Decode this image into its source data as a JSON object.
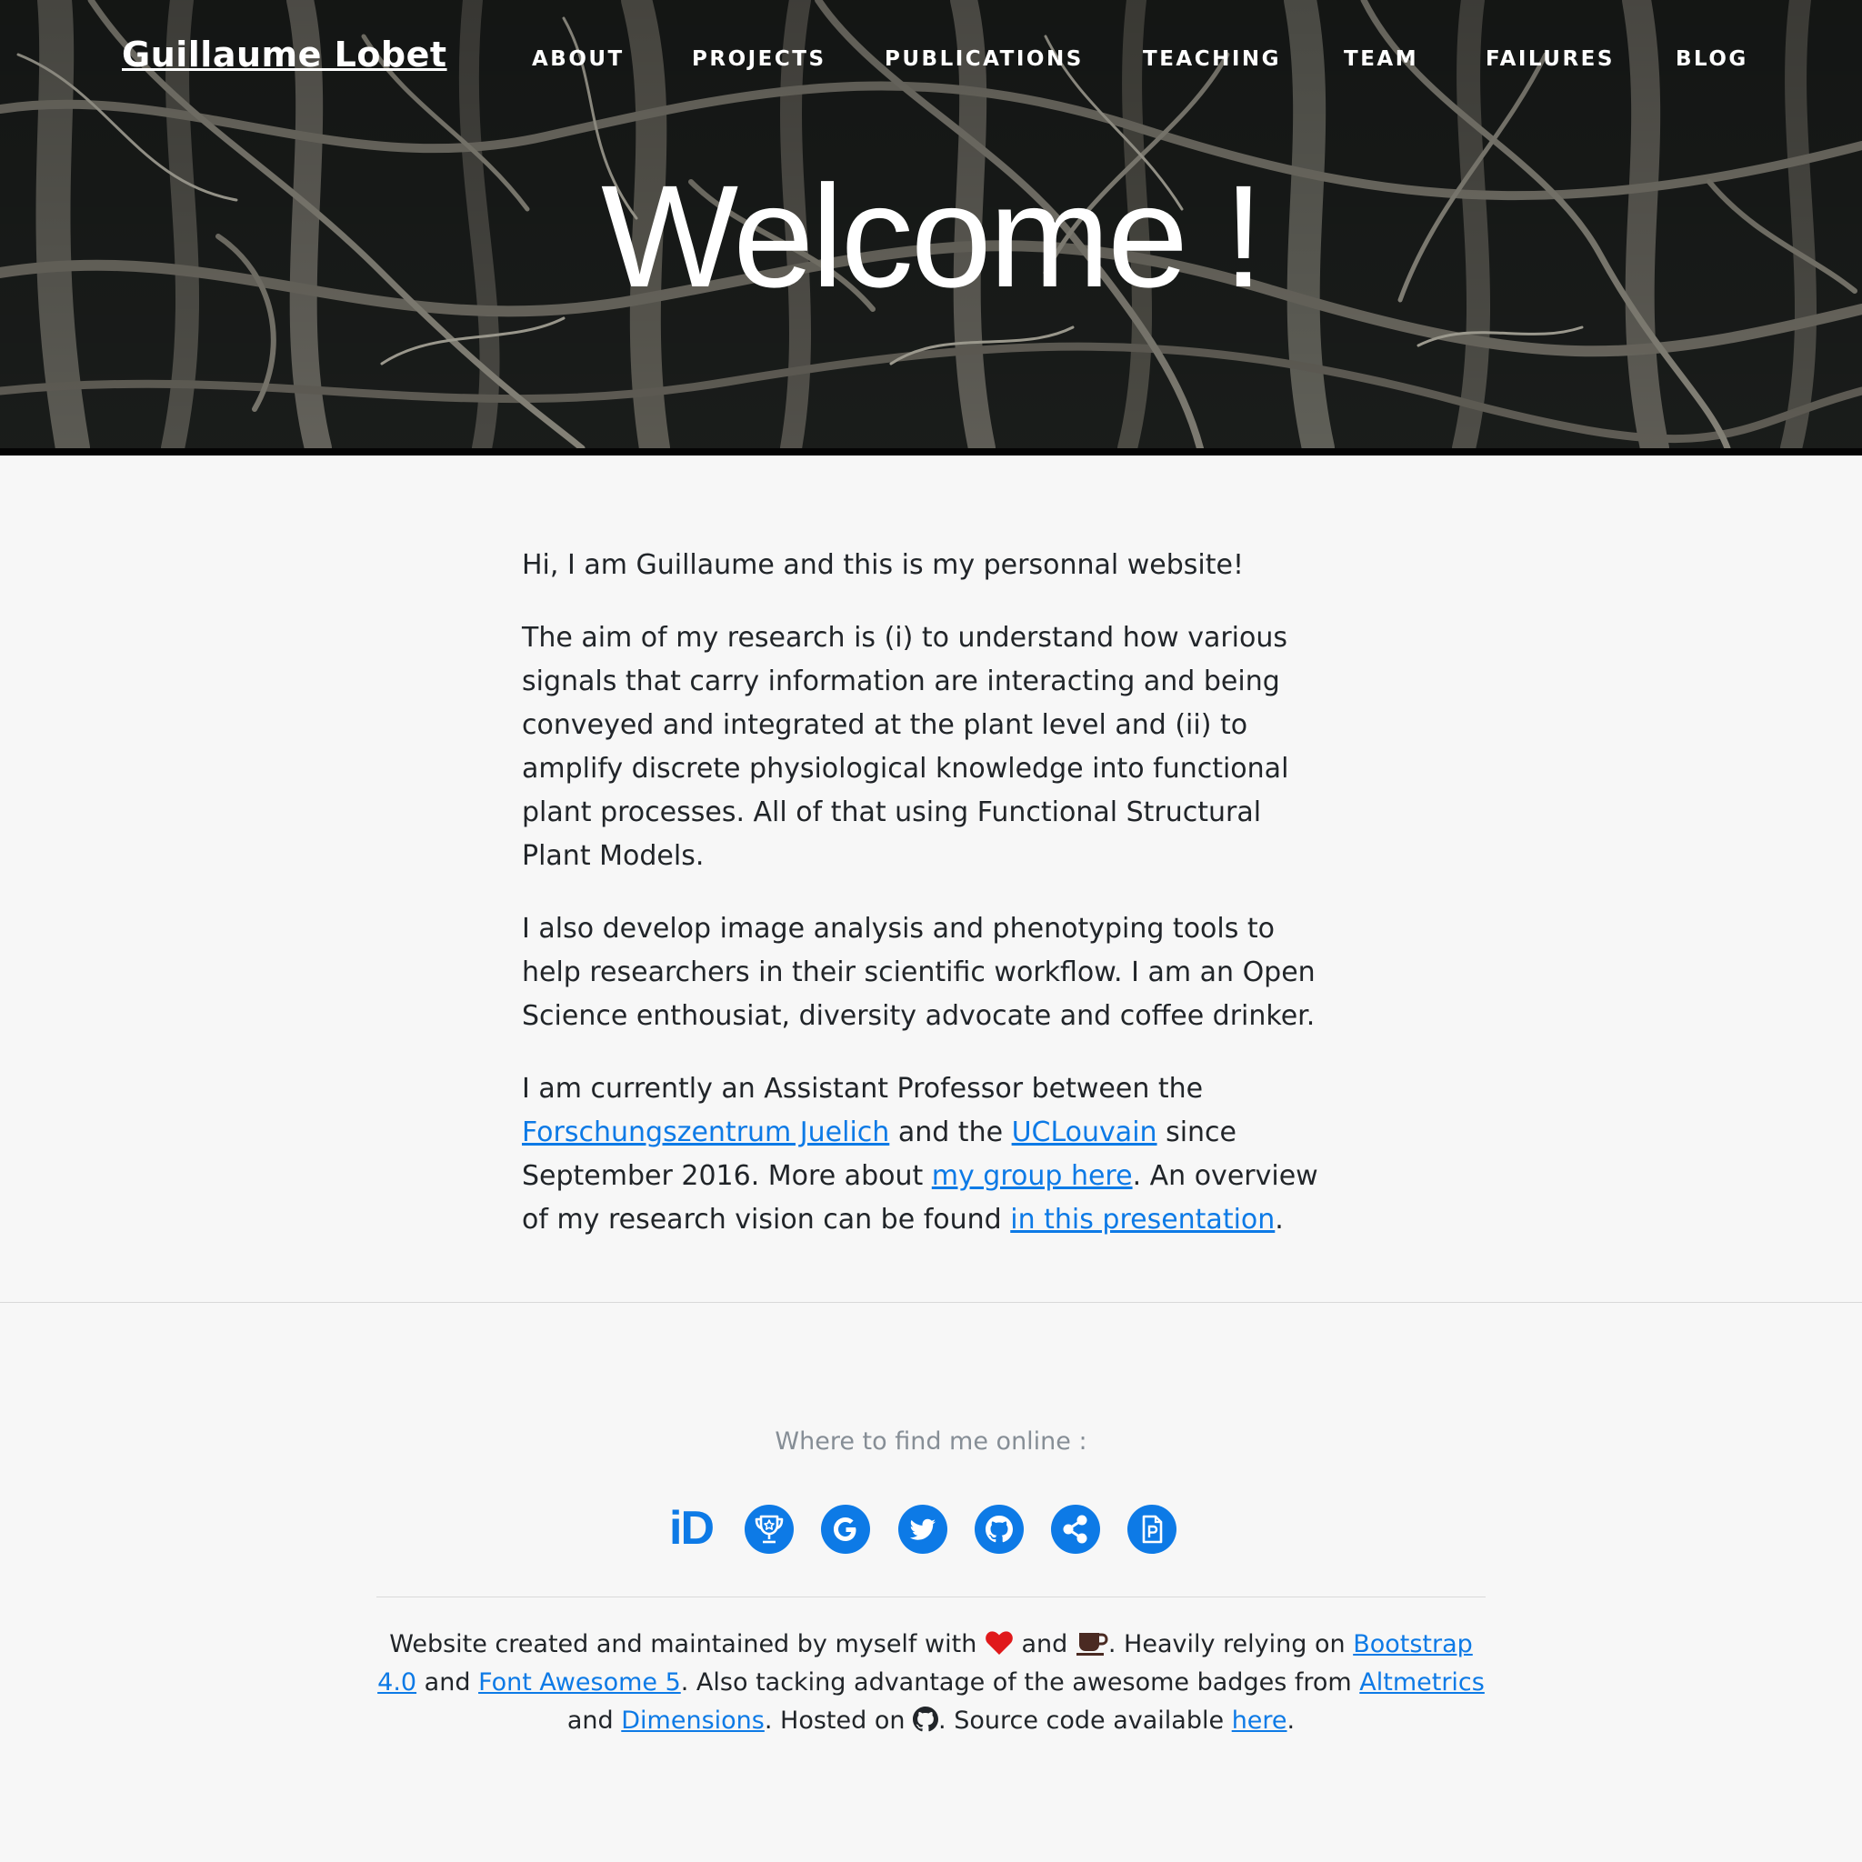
{
  "header": {
    "brand": "Guillaume Lobet",
    "nav": [
      "ABOUT",
      "PROJECTS",
      "PUBLICATIONS",
      "TEACHING",
      "TEAM",
      "FAILURES",
      "BLOG"
    ],
    "title": "Welcome !"
  },
  "intro": {
    "p1": "Hi, I am Guillaume and this is my personnal website!",
    "p2": "The aim of my research is (i) to understand how various signals that carry information are interacting and being conveyed and integrated at the plant level and (ii) to amplify discrete physiological knowledge into functional plant processes. All of that using Functional Structural Plant Models.",
    "p3": "I also develop image analysis and phenotyping tools to help researchers in their scientific workflow. I am an Open Science enthousiat, diversity advocate and coffee drinker.",
    "p4": {
      "t1": "I am currently an Assistant Professor between the ",
      "link1": "Forschungszentrum Juelich",
      "t2": " and the ",
      "link2": "UCLouvain",
      "t3": " since September 2016. More about ",
      "link3": "my group here",
      "t4": ". An overview of my research vision can be found ",
      "link4": "in this presentation",
      "t5": "."
    }
  },
  "social": {
    "heading": "Where to find me online :",
    "orcid_label": "iD",
    "icons": [
      "orcid-icon",
      "trophy-icon",
      "google-icon",
      "twitter-icon",
      "github-icon",
      "share-icon",
      "file-powerpoint-icon"
    ]
  },
  "footer": {
    "t1": "Website created and maintained by myself with ",
    "t2": " and ",
    "t3": ". Heavily relying on ",
    "link_bootstrap": "Bootstrap 4.0",
    "t4": " and ",
    "link_fa": "Font Awesome 5",
    "t5": ". Also tacking advantage of the awesome badges from ",
    "link_altmetrics": "Altmetrics",
    "t6": " and ",
    "link_dimensions": "Dimensions",
    "t7": ". Hosted on ",
    "t8": ". Source code available ",
    "link_here": "here",
    "t9": "."
  },
  "colors": {
    "link": "#0d7ae6",
    "heart": "#e0191b",
    "coffee": "#4a2a22",
    "background": "#f7f7f7"
  }
}
